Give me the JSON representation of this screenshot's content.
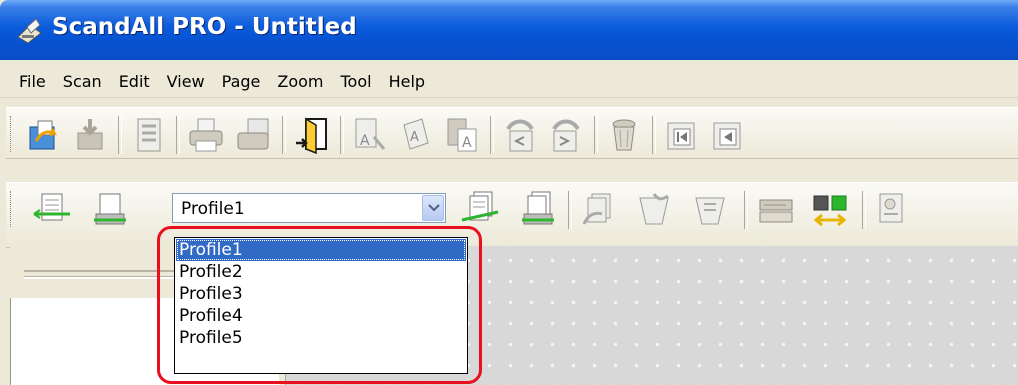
{
  "window": {
    "title": "ScandAll PRO - Untitled",
    "app_icon": "scanner-icon"
  },
  "menu": {
    "items": [
      "File",
      "Scan",
      "Edit",
      "View",
      "Page",
      "Zoom",
      "Tool",
      "Help"
    ]
  },
  "toolbar1": {
    "buttons": [
      "open-file-icon",
      "import-icon",
      "list-view-icon",
      "print-icon",
      "fax-icon",
      "exit-door-icon",
      "ocr-scan-icon",
      "ocr-rotate-icon",
      "ocr-text-icon",
      "rotate-left-icon",
      "rotate-right-icon",
      "delete-bin-icon",
      "first-page-icon",
      "prev-page-icon"
    ]
  },
  "toolbar2": {
    "profile_select": {
      "selected": "Profile1",
      "options": [
        "Profile1",
        "Profile2",
        "Profile3",
        "Profile4",
        "Profile5"
      ]
    },
    "buttons": [
      "scan-page-icon",
      "scan-settings-icon",
      "batch-scan-icon",
      "batch-settings-icon",
      "scan-to-folder-icon",
      "scan-to-mail-icon",
      "scan-to-printer-icon",
      "scanner-settings-icon",
      "network-scan-icon",
      "profile-editor-icon"
    ]
  },
  "colors": {
    "title_bar": "#0652d1",
    "selection": "#316ac5",
    "highlight_annotation": "#e8101e"
  }
}
